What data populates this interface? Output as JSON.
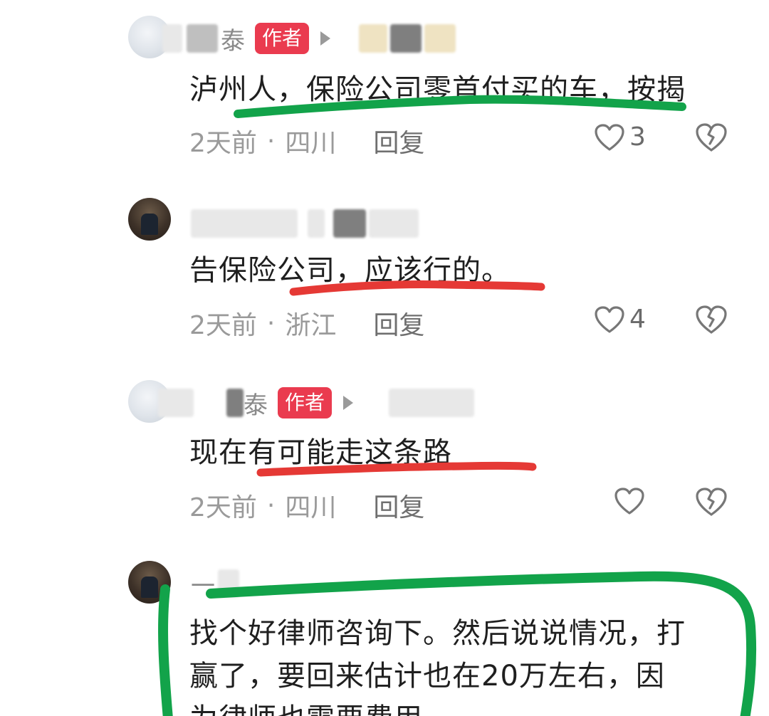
{
  "comments": [
    {
      "name_suffix": "泰",
      "badge": "作者",
      "text": "泸州人，保险公司零首付买的车，按揭",
      "time": "2天前",
      "location": "四川",
      "reply": "回复",
      "likes": "3"
    },
    {
      "name_suffix": "",
      "badge": "",
      "text": "告保险公司，应该行的。",
      "time": "2天前",
      "location": "浙江",
      "reply": "回复",
      "likes": "4"
    },
    {
      "name_suffix": "泰",
      "badge": "作者",
      "text": "现在有可能走这条路",
      "time": "2天前",
      "location": "四川",
      "reply": "回复",
      "likes": ""
    },
    {
      "name_suffix": "一",
      "badge": "",
      "text_lines": [
        "找个好律师咨询下。然后说说情况，打",
        "赢了，要回来估计也在20万左右，因",
        "为律师也需要费用"
      ]
    }
  ],
  "separator_dot": "·",
  "icons": {
    "like": "heart-outline-icon",
    "dislike": "broken-heart-icon",
    "reply_arrow": "reply-arrow-icon"
  },
  "colors": {
    "author_badge": "#ea3b4f",
    "highlight_green": "#12a34a",
    "highlight_red": "#e53935"
  }
}
